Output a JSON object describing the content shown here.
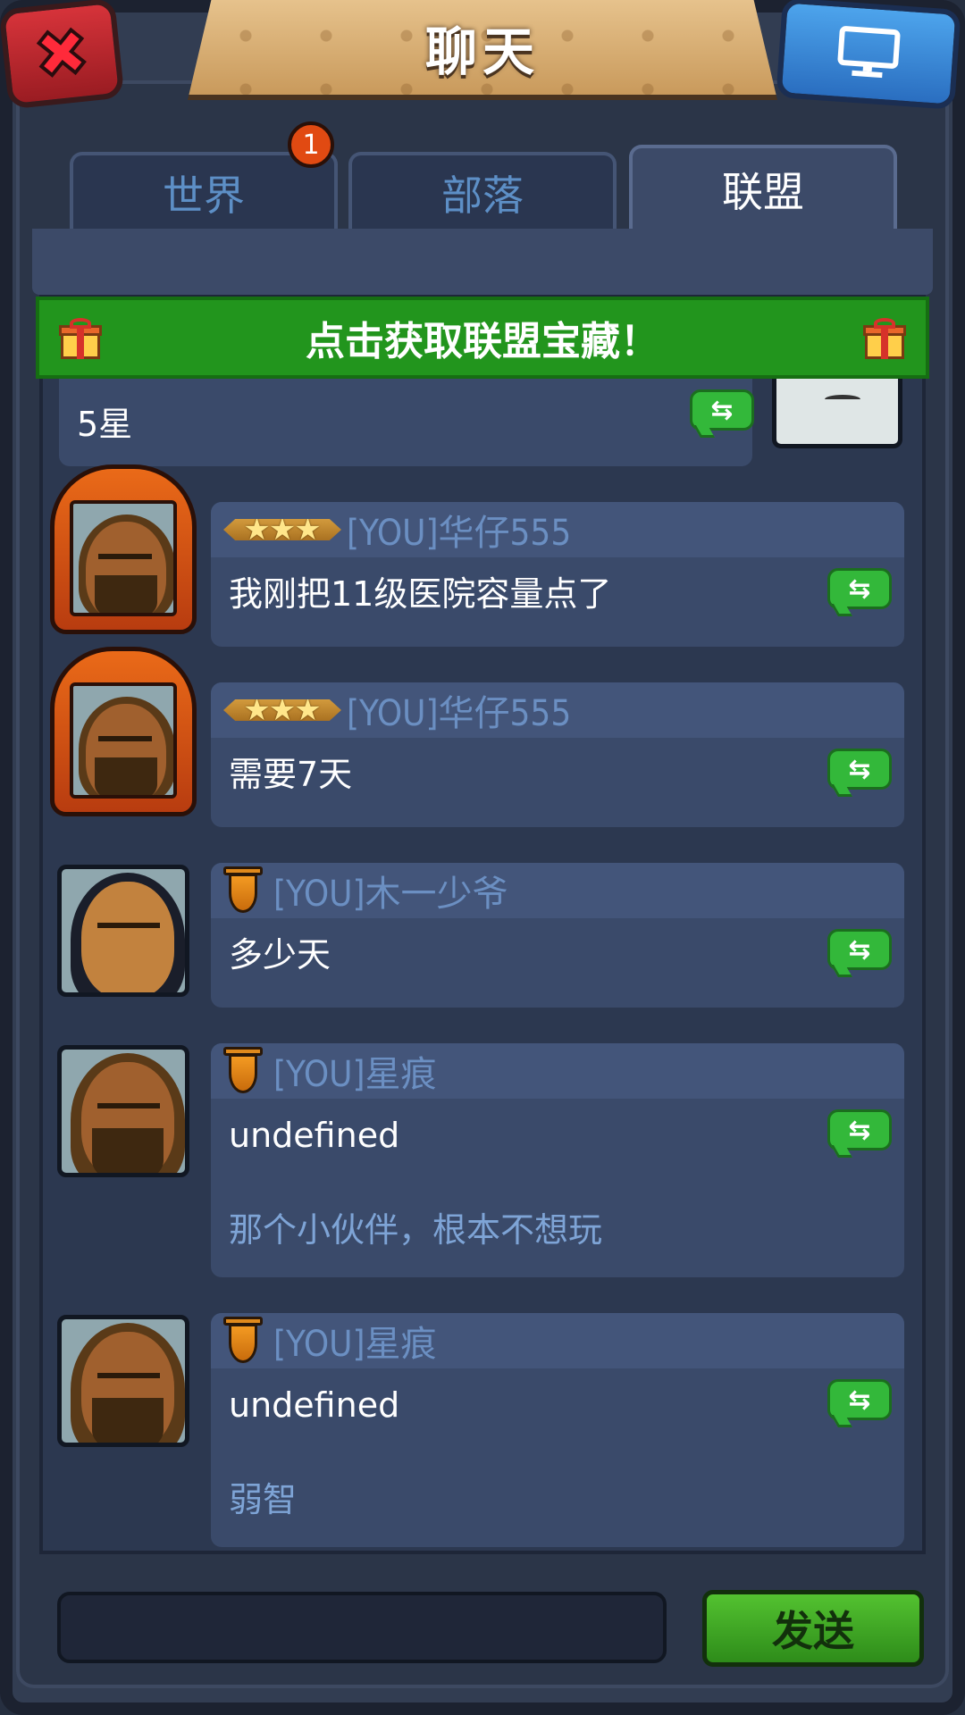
{
  "header": {
    "title": "聊天",
    "close_icon": "close-icon",
    "screen_icon": "monitor-icon"
  },
  "tabs": [
    {
      "label": "世界",
      "badge": "1",
      "active": false
    },
    {
      "label": "部落",
      "active": false
    },
    {
      "label": "联盟",
      "active": true
    }
  ],
  "treasure_banner": {
    "label": "点击获取联盟宝藏！",
    "icon": "gift-icon"
  },
  "partial_message": {
    "text": "5星"
  },
  "messages": [
    {
      "name": "[YOU]华仔555",
      "text": "我刚把11级医院容量点了",
      "rank": "stars"
    },
    {
      "name": "[YOU]华仔555",
      "text": "需要7天",
      "rank": "stars"
    },
    {
      "name": "[YOU]木一少爷",
      "text": "多少天",
      "rank": "shield"
    },
    {
      "name": "[YOU]星痕",
      "text": "undefined",
      "text2": "那个小伙伴，根本不想玩",
      "rank": "shield"
    },
    {
      "name": "[YOU]星痕",
      "text": "undefined",
      "text2": "弱智",
      "rank": "shield"
    }
  ],
  "share_label": "⇆",
  "input": {
    "value": "",
    "placeholder": ""
  },
  "send_button": {
    "label": "发送"
  },
  "colors": {
    "accent_green": "#22951d",
    "tab_active": "#3c4a68",
    "badge": "#e14a12"
  }
}
